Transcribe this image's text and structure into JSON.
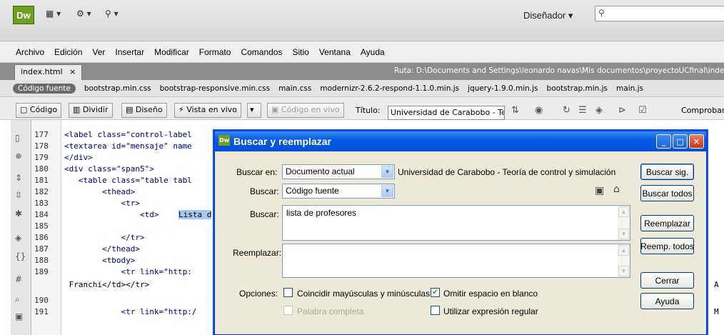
{
  "app": {
    "logo": "Dw",
    "workspace_label": "Diseñador",
    "search_placeholder": ""
  },
  "menu": [
    "Archivo",
    "Edición",
    "Ver",
    "Insertar",
    "Modificar",
    "Formato",
    "Comandos",
    "Sitio",
    "Ventana",
    "Ayuda"
  ],
  "document_tab": {
    "label": "index.html",
    "close_glyph": "×",
    "path": "Ruta: D:\\Documents and Settings\\leonardo navas\\Mis documentos\\proyectoUCfinal\\inde"
  },
  "related_files": [
    "Código fuente",
    "bootstrap.min.css",
    "bootstrap-responsive.min.css",
    "main.css",
    "modernizr-2.6.2-respond-1.1.0.min.js",
    "jquery-1.9.0.min.js",
    "bootstrap.min.js",
    "main.js"
  ],
  "toolbar": {
    "code_label": "Código",
    "split_label": "Dividir",
    "design_label": "Diseño",
    "live_view_label": "Vista en vivo",
    "live_code_label": "Código en vivo",
    "title_label": "Título:",
    "title_value": "Universidad de Carabobo - Te",
    "check_label": "Comprobar"
  },
  "code": {
    "line_numbers": [
      "177",
      "178",
      "179",
      "180",
      "181",
      "182",
      "183",
      "184",
      "185",
      "186",
      "187",
      "188",
      "189",
      "190",
      "191"
    ],
    "lines": [
      "<label class=\"control-label",
      "<textarea id=\"mensaje\" name",
      "</div>",
      "<div class=\"span5\">",
      "   <table class=\"table tabl",
      "        <thead>",
      "            <tr>",
      "                <td>",
      "",
      "            </tr>",
      "        </thead>",
      "        <tbody>",
      "            <tr link=\"http:",
      "",
      "            <tr link=\"http:/"
    ],
    "selected_text": "Lista d",
    "wrap_line": " Franchi</td></tr>",
    "right_fragment_1": "A",
    "right_fragment_2": "M"
  },
  "dialog": {
    "title": "Buscar y reemplazar",
    "search_in_label": "Buscar en:",
    "search_in_value": "Documento actual",
    "search_in_info": "Universidad de Carabobo - Teoría de control y simulación",
    "search_label": "Buscar:",
    "search_type_value": "Código fuente",
    "search_text_label": "Buscar:",
    "search_text_value": "lista de profesores",
    "replace_label": "Reemplazar:",
    "replace_value": "",
    "options_label": "Opciones:",
    "options": {
      "match_case": {
        "label": "Coincidir mayúsculas y minúsculas",
        "checked": false
      },
      "ignore_whitespace": {
        "label": "Omitir espacio en blanco",
        "checked": true
      },
      "whole_word": {
        "label": "Palabra completa",
        "checked": false,
        "disabled": true
      },
      "regex": {
        "label": "Utilizar expresión regular",
        "checked": false
      }
    },
    "buttons": {
      "find_next": "Buscar sig.",
      "find_all": "Buscar todos",
      "replace": "Reemplazar",
      "replace_all": "Reemp. todos",
      "close": "Cerrar",
      "help": "Ayuda"
    }
  }
}
